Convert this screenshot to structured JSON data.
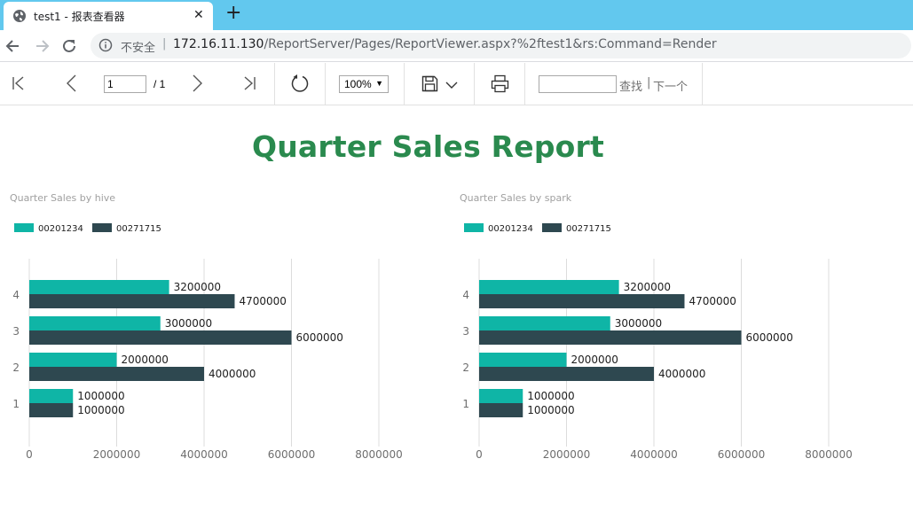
{
  "browser": {
    "tab_title": "test1 - 报表查看器",
    "close_glyph": "✕",
    "new_tab_glyph": "+",
    "insecure_label": "不安全",
    "separator": "|",
    "url_host": "172.16.11.130",
    "url_path": "/ReportServer/Pages/ReportViewer.aspx?%2ftest1&rs:Command=Render"
  },
  "toolbar": {
    "page_current": "1",
    "page_total": "/ 1",
    "zoom": "100%",
    "zoom_arrow": "▼",
    "find_label": "查找",
    "find_separator": "|",
    "next_label": "下一个",
    "icons": [
      "first-page-icon",
      "previous-page-icon",
      "next-page-icon",
      "last-page-icon",
      "refresh-icon",
      "save-icon",
      "chevron-down-icon",
      "print-icon"
    ]
  },
  "report": {
    "title": "Quarter Sales Report"
  },
  "colors": {
    "series_teal": "#0fb5a6",
    "series_dark": "#2e4850",
    "title_green": "#2a8a4e"
  },
  "chart_data": [
    {
      "type": "bar",
      "orientation": "horizontal",
      "title": "Quarter Sales by hive",
      "categories": [
        "1",
        "2",
        "3",
        "4"
      ],
      "series": [
        {
          "name": "00201234",
          "values": [
            1000000,
            2000000,
            3000000,
            3200000
          ],
          "color": "#0fb5a6"
        },
        {
          "name": "00271715",
          "values": [
            1000000,
            4000000,
            6000000,
            4700000
          ],
          "color": "#2e4850"
        }
      ],
      "xlim": [
        0,
        8000000
      ],
      "xticks": [
        "0",
        "2000000",
        "4000000",
        "6000000",
        "8000000"
      ],
      "legend": "top-left",
      "grid": true
    },
    {
      "type": "bar",
      "orientation": "horizontal",
      "title": "Quarter Sales by spark",
      "categories": [
        "1",
        "2",
        "3",
        "4"
      ],
      "series": [
        {
          "name": "00201234",
          "values": [
            1000000,
            2000000,
            3000000,
            3200000
          ],
          "color": "#0fb5a6"
        },
        {
          "name": "00271715",
          "values": [
            1000000,
            4000000,
            6000000,
            4700000
          ],
          "color": "#2e4850"
        }
      ],
      "xlim": [
        0,
        8000000
      ],
      "xticks": [
        "0",
        "2000000",
        "4000000",
        "6000000",
        "8000000"
      ],
      "legend": "top-left",
      "grid": true
    }
  ]
}
